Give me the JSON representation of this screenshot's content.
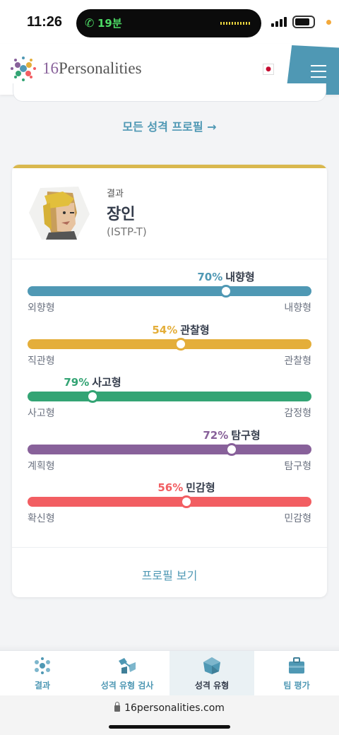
{
  "status": {
    "time": "11:26",
    "call_time": "19분"
  },
  "header": {
    "logo_prefix": "16",
    "logo_suffix": "Personalities",
    "flag_label": "KR"
  },
  "links": {
    "all_profiles": "모든 성격 프로필 →",
    "view_profile": "프로필 보기"
  },
  "result": {
    "label": "결과",
    "name": "장인",
    "code": "(ISTP-T)"
  },
  "traits": [
    {
      "pct": "70%",
      "name": "내향형",
      "left": "외향형",
      "right": "내향형",
      "value": 0.7,
      "color": "#4f98b4"
    },
    {
      "pct": "54%",
      "name": "관찰형",
      "left": "직관형",
      "right": "관찰형",
      "value": 0.54,
      "color": "#e4ae3a"
    },
    {
      "pct": "79%",
      "name": "사고형",
      "left": "사고형",
      "right": "감정형",
      "value": 0.23,
      "color": "#33a474"
    },
    {
      "pct": "72%",
      "name": "탐구형",
      "left": "계획형",
      "right": "탐구형",
      "value": 0.72,
      "color": "#88619a"
    },
    {
      "pct": "56%",
      "name": "민감형",
      "left": "확신형",
      "right": "민감형",
      "value": 0.56,
      "color": "#f25e62"
    }
  ],
  "tabs": [
    {
      "label": "결과",
      "icon": "results-icon"
    },
    {
      "label": "성격 유형 검사",
      "icon": "test-icon"
    },
    {
      "label": "성격 유형",
      "icon": "types-icon"
    },
    {
      "label": "팀 평가",
      "icon": "team-icon"
    }
  ],
  "browser": {
    "url": "16personalities.com"
  }
}
